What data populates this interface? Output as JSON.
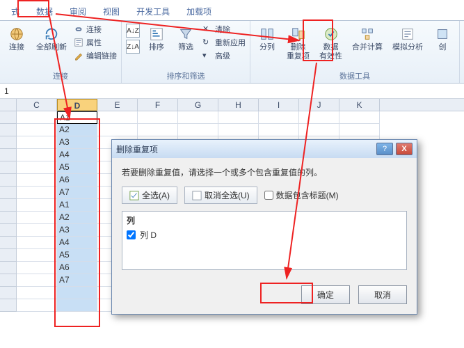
{
  "tabs": {
    "t0": "式",
    "t1": "数据",
    "t2": "审阅",
    "t3": "视图",
    "t4": "开发工具",
    "t5": "加载项"
  },
  "ribbon": {
    "conn_btn": "连接",
    "refresh": "全部刷新",
    "conn_small": "连接",
    "props": "属性",
    "editlinks": "编辑链接",
    "group_conn": "连接",
    "sort": "排序",
    "filter": "筛选",
    "clear": "清除",
    "reapply": "重新应用",
    "advanced": "高级",
    "group_sort": "排序和筛选",
    "split": "分列",
    "remdup": "删除",
    "remdup2": "重复项",
    "valid": "数据",
    "valid2": "有效性",
    "consol": "合并计算",
    "whatif": "模拟分析",
    "create": "创",
    "group_data": "数据工具"
  },
  "formula": "1",
  "cols": [
    "C",
    "D",
    "E",
    "F",
    "G",
    "H",
    "I",
    "J",
    "K"
  ],
  "col_d": [
    "A1",
    "A2",
    "A3",
    "A4",
    "A5",
    "A6",
    "A7",
    "A1",
    "A2",
    "A3",
    "A4",
    "A5",
    "A6",
    "A7"
  ],
  "dialog": {
    "title": "删除重复项",
    "msg": "若要删除重复值，请选择一个或多个包含重复值的列。",
    "selectall": "全选(A)",
    "unselectall": "取消全选(U)",
    "dataheader": "数据包含标题(M)",
    "col_head": "列",
    "col_d": "列 D",
    "ok": "确定",
    "cancel": "取消"
  }
}
